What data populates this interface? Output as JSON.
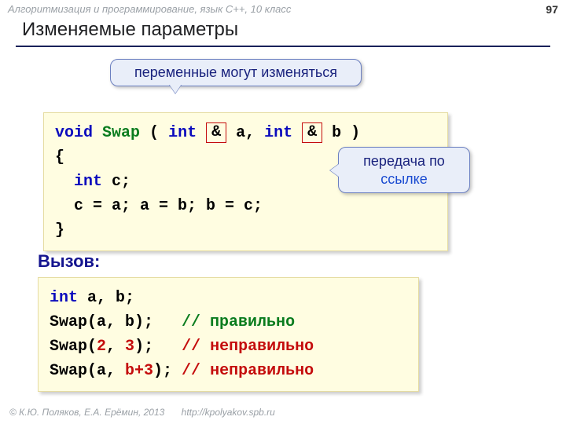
{
  "header": {
    "breadcrumb": "Алгоритмизация и программирование, язык  C++, 10 класс",
    "page_number": "97",
    "title": "Изменяемые параметры"
  },
  "callouts": {
    "vars_change": "переменные могут изменяться",
    "by_ref_line1": "передача по",
    "by_ref_line2": "ссылке"
  },
  "code1": {
    "kw_void": "void",
    "fn_name": "Swap",
    "paren_open": " ( ",
    "kw_int1": "int",
    "amp": "&",
    "param_a": " a, ",
    "kw_int2": "int",
    "param_b": " b )",
    "brace_open": "{",
    "decl": "  int",
    "decl_tail": " c;",
    "body": "  c = a; a = b; b = c;",
    "brace_close": "}"
  },
  "subheader": "Вызов:",
  "code2": {
    "l1_kw": "int",
    "l1_tail": " a, b;",
    "l2_call": "Swap(a, b);   ",
    "l2_slashes": "// ",
    "l2_cmt": "правильно",
    "l3_pre": "Swap(",
    "l3_n1": "2",
    "l3_mid": ", ",
    "l3_n2": "3",
    "l3_post": ");   ",
    "l3_slashes": "// ",
    "l3_cmt": "неправильно",
    "l4_pre": "Swap(a, ",
    "l4_expr": "b+3",
    "l4_post": "); ",
    "l4_slashes": "// ",
    "l4_cmt": "неправильно"
  },
  "footer": {
    "copyright": "© К.Ю. Поляков, Е.А. Ерёмин, 2013",
    "url": "http://kpolyakov.spb.ru"
  }
}
